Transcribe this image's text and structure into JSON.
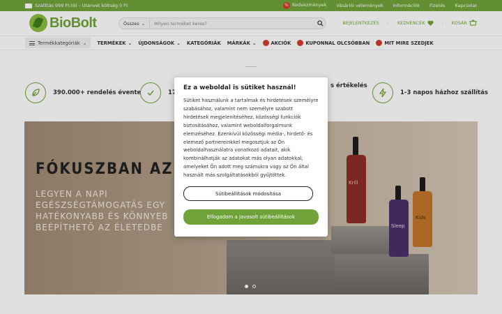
{
  "topbar": {
    "shipping_text": "Szállítás 999 Ft-tól – Utánvét költség 0 Ft",
    "links": [
      "Kedvezmények",
      "Vásárlói vélemények",
      "Információk",
      "Fizetés",
      "Kapcsolat"
    ]
  },
  "header": {
    "logo_text": "BioBolt",
    "search_category": "Összes",
    "search_placeholder": "Milyen terméket keres?",
    "login_label": "BEJELENTKEZÉS",
    "favorites_label": "KEDVENCEK",
    "cart_label": "KOSÁR"
  },
  "nav": {
    "categories_button": "Termékkategóriák",
    "items": [
      "TERMÉKEK",
      "ÚJDONSÁGOK",
      "KATEGÓRIÁK",
      "MÁRKÁK",
      "AKCIÓK",
      "KUPONNAL OLCSÓBBAN",
      "MIT MIRE SZEDJEK"
    ]
  },
  "features": [
    {
      "text": "390.000+ rendelés évente",
      "icon": "leaf-icon"
    },
    {
      "text": "17",
      "icon": "check-leaf-icon"
    },
    {
      "text": "s értékelés",
      "icon": "star-icon"
    },
    {
      "text": "1-3 napos házhoz szállítás",
      "icon": "lightning-icon"
    }
  ],
  "hero": {
    "title": "FÓKUSZBAN AZ EG",
    "subtitle_lines": [
      "LEGYEN A NAPI",
      "EGÉSZSÉGTÁMOGATÁS EGY",
      "HATÉKONYABB ÉS KÖNNYEB",
      "BEÉPÍTHETŐ AZ ÉLETEDBE"
    ],
    "bottle_labels": [
      "Krill",
      "Sleep",
      "Kids"
    ],
    "slides": 2,
    "active_slide": 1
  },
  "cookie_modal": {
    "title": "Ez a weboldal is sütiket használ!",
    "body": "Sütiket használunk a tartalmak és hirdetések személyre szabásához, valamint nem személyre szabott hirdetések megjelenítéséhez, közösségi funkciók biztosításához, valamint weboldalforgalmunk elemzéséhez. Ezenkívül közösségi média-, hirdető- és elemező partnereinkkel megosztjuk az Ön weboldalhasználatra vonatkozó adatait, akik kombinálhatják az adatokat más olyan adatokkal, amelyeket Ön adott meg számukra vagy az Ön által használt más szolgáltatásokból gyűjtöttek.",
    "settings_button": "Sütibeállítások módosítása",
    "accept_button": "Elfogadom a javasolt sütibeállítások"
  },
  "colors": {
    "brand_green": "#6fa33a",
    "accent_red": "#d53b2c"
  }
}
